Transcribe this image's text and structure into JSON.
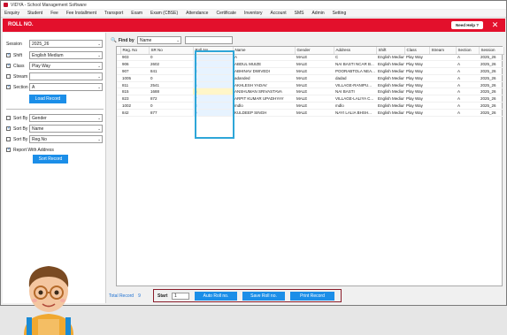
{
  "window": {
    "title": "VIDYA - School Management Software"
  },
  "menu": [
    "Enquiry",
    "Student",
    "Fee",
    "Fee Installment",
    "Transport",
    "Exam",
    "Exam (CBSE)",
    "Attendance",
    "Certificate",
    "Inventory",
    "Account",
    "SMS",
    "Admin",
    "Setting"
  ],
  "header": {
    "title": "ROLL NO.",
    "help_label": "Need Help ?",
    "close_label": "✕"
  },
  "filters": {
    "session_label": "Session",
    "session_value": "2025_26",
    "shift_label": "Shift",
    "shift_value": "English Medium",
    "class_label": "Class",
    "class_value": "Play Way",
    "stream_label": "Stream",
    "stream_value": "",
    "section_label": "Section",
    "section_value": "A",
    "load_button": "Load Record",
    "sort1_label": "Sort By",
    "sort1_value": "Gender",
    "sort2_label": "Sort By",
    "sort2_value": "Name",
    "sort3_label": "Sort By",
    "sort3_value": "Reg.No",
    "report_with_address": "Report With Address",
    "sort_button": "Sort Record"
  },
  "find": {
    "label": "Find by",
    "field_value": "Name",
    "search_value": ""
  },
  "table": {
    "columns": [
      "Reg. No",
      "SR No",
      "Roll No.",
      "Name",
      "Gender",
      "Address",
      "Shift",
      "Class",
      "Stream",
      "Section",
      "Session"
    ],
    "rows": [
      [
        "903",
        "0",
        "1",
        "A",
        "MALE",
        "C",
        "English Medium",
        "Play Way",
        "",
        "A",
        "2025_26"
      ],
      [
        "906",
        "2602",
        "2",
        "ABDUL MUIZE",
        "MALE",
        "NAI BASTI NCAR B...",
        "English Medium",
        "Play Way",
        "",
        "A",
        "2025_26"
      ],
      [
        "907",
        "841",
        "3",
        "ABHINAV DWIVEDI",
        "MALE",
        "POORABTOLA NEA...",
        "English Medium",
        "Play Way",
        "",
        "A",
        "2025_26"
      ],
      [
        "1005",
        "0",
        "4",
        "adanded",
        "MALE",
        "dadad",
        "English Medium",
        "Play Way",
        "",
        "A",
        "2025_26"
      ],
      [
        "811",
        "2541",
        "5",
        "AKHLESH YADAV",
        "MALE",
        "VILLAGE-RANIPU...",
        "English Medium",
        "Play Way",
        "",
        "A",
        "2025_26"
      ],
      [
        "815",
        "1688",
        "6",
        "ANSHUMAN SRIVASTAVA",
        "MALE",
        "NAI BASTI",
        "English Medium",
        "Play Way",
        "",
        "A",
        "2025_26"
      ],
      [
        "823",
        "872",
        "7",
        "ARPIT KUMAR UPADHYAY",
        "MALE",
        "VILLAGE-LALIYA C...",
        "English Medium",
        "Play Way",
        "",
        "A",
        "2025_26"
      ],
      [
        "1002",
        "0",
        "8",
        "mdlo",
        "MALE",
        "mdlo",
        "English Medium",
        "Play Way",
        "",
        "A",
        "2025_26"
      ],
      [
        "842",
        "877",
        "9",
        "KULDEEP SINGH",
        "MALE",
        "NAYI LALIA BHSH...",
        "English Medium",
        "Play Way",
        "",
        "A",
        "2025_26"
      ]
    ]
  },
  "footer": {
    "total_label": "Total Record",
    "total_value": "9",
    "start_label": "Start",
    "start_value": "1",
    "auto_button": "Auto Roll no.",
    "save_button": "Save Roll no.",
    "print_button": "Print Record"
  }
}
